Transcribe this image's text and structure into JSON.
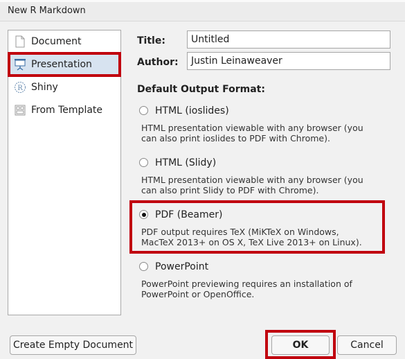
{
  "window": {
    "title": "New R Markdown"
  },
  "sidebar": {
    "items": [
      {
        "label": "Document",
        "icon": "document-icon"
      },
      {
        "label": "Presentation",
        "icon": "presentation-icon",
        "selected": true
      },
      {
        "label": "Shiny",
        "icon": "shiny-r-icon"
      },
      {
        "label": "From Template",
        "icon": "template-icon"
      }
    ]
  },
  "form": {
    "title_label": "Title:",
    "title_value": "Untitled",
    "author_label": "Author:",
    "author_value": "Justin Leinaweaver",
    "format_heading": "Default Output Format:"
  },
  "formats": [
    {
      "label": "HTML (ioslides)",
      "checked": false,
      "desc1": "HTML presentation viewable with any browser (you",
      "desc2": "can also print ioslides to PDF with Chrome)."
    },
    {
      "label": "HTML (Slidy)",
      "checked": false,
      "desc1": "HTML presentation viewable with any browser (you",
      "desc2": "can also print Slidy to PDF with Chrome)."
    },
    {
      "label": "PDF (Beamer)",
      "checked": true,
      "desc1": "PDF output requires TeX (MiKTeX on Windows,",
      "desc2": "MacTeX 2013+ on OS X, TeX Live 2013+ on Linux)."
    },
    {
      "label": "PowerPoint",
      "checked": false,
      "desc1": "PowerPoint previewing requires an installation of",
      "desc2": "PowerPoint or OpenOffice."
    }
  ],
  "buttons": {
    "create_empty": "Create Empty Document",
    "ok": "OK",
    "cancel": "Cancel"
  },
  "colors": {
    "highlight": "#c0000e",
    "selected_bg": "#d7e3f0",
    "presentation_icon": "#3a6ea5",
    "shiny_icon": "#6d8fb3"
  }
}
